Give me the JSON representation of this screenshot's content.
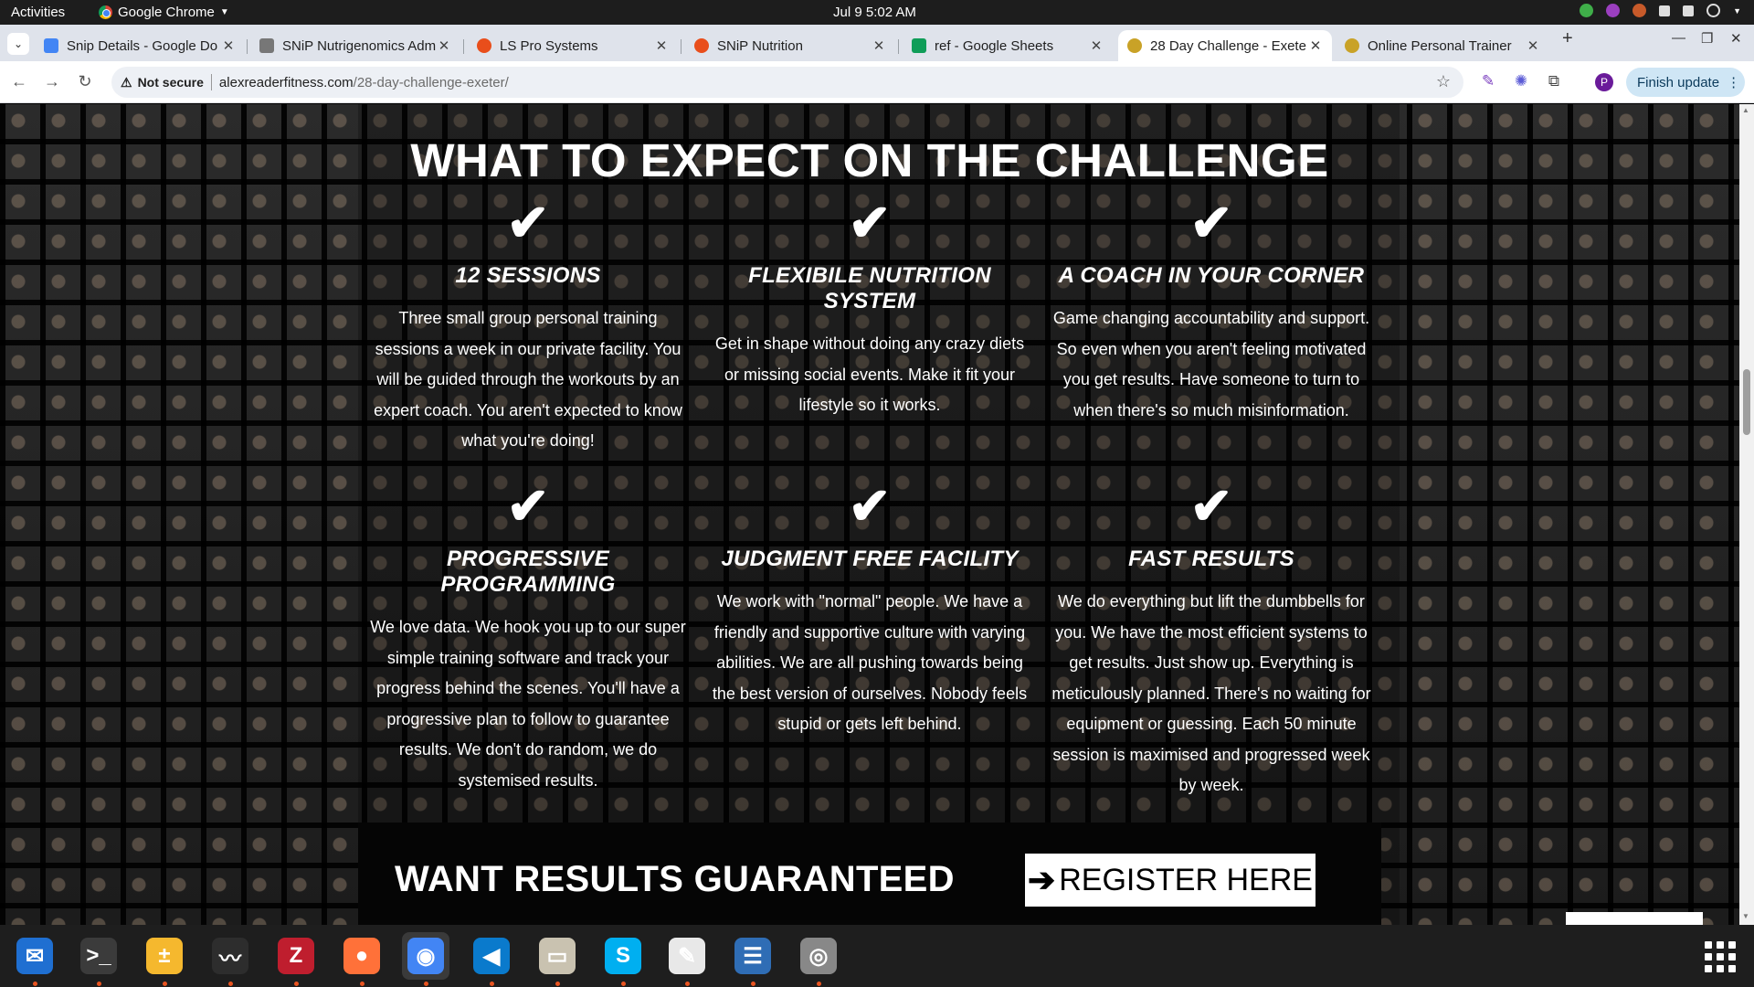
{
  "system": {
    "activities_label": "Activities",
    "app_menu_label": "Google Chrome",
    "clock": "Jul 9   5:02 AM"
  },
  "tabs": [
    {
      "label": "Snip Details - Google Do",
      "favicon_color": "#4285f4",
      "icon": "google-docs-icon"
    },
    {
      "label": "SNiP Nutrigenomics Adm",
      "favicon_color": "#777777",
      "icon": "snip-logo-icon"
    },
    {
      "label": "LS Pro Systems",
      "favicon_color": "#e94e1b",
      "icon": "ls-pro-icon"
    },
    {
      "label": "SNiP Nutrition",
      "favicon_color": "#e94e1b",
      "icon": "snip-nutrition-icon"
    },
    {
      "label": "ref - Google Sheets",
      "favicon_color": "#0f9d58",
      "icon": "google-sheets-icon"
    },
    {
      "label": "28 Day Challenge - Exete",
      "favicon_color": "#c9a227",
      "icon": "site-favicon-icon"
    },
    {
      "label": "Online Personal Trainer",
      "favicon_color": "#c9a227",
      "icon": "site-favicon-icon"
    }
  ],
  "toolbar": {
    "security_label": "Not secure",
    "url_host": "alexreaderfitness.com",
    "url_path": "/28-day-challenge-exeter/",
    "profile_initial": "P",
    "finish_update_label": "Finish update"
  },
  "page": {
    "heading": "WHAT TO EXPECT ON THE CHALLENGE",
    "features": [
      {
        "title": "12 SESSIONS",
        "text": "Three small group personal training sessions a week in our private facility. You will be guided through the workouts by an expert coach. You aren't expected to know what you're doing!"
      },
      {
        "title": "FLEXIBILE NUTRITION SYSTEM",
        "text": "Get in shape without doing any crazy diets or missing social events. Make it fit your lifestyle so it works."
      },
      {
        "title": "A COACH IN YOUR CORNER",
        "text": "Game changing accountability and support. So even when you aren't feeling motivated you get results. Have someone to turn to when there's so much misinformation."
      },
      {
        "title": "PROGRESSIVE PROGRAMMING",
        "text": "We love data. We hook you up to our super simple training software and track your progress behind the scenes. You'll have a progressive plan to follow to guarantee results. We don't do random, we do systemised results."
      },
      {
        "title": "JUDGMENT FREE FACILITY",
        "text": "We work with \"normal\" people. We have a friendly and supportive culture with varying abilities. We are all pushing towards being the best version of ourselves. Nobody feels stupid or gets left behind."
      },
      {
        "title": "FAST RESULTS",
        "text": "We do everything but lift the dumbbells for you. We have the most efficient systems to get results. Just show up. Everything is meticulously planned. There's no waiting for equipment or guessing. Each 50 minute session is maximised and progressed week by week."
      }
    ],
    "check_glyph": "✔",
    "cta_text": "WANT RESULTS GUARANTEED",
    "cta_button_label": "REGISTER HERE",
    "cta_arrow": "➔"
  },
  "dock": [
    {
      "name": "thunderbird-icon",
      "color": "#1f6fd1",
      "glyph": "✉",
      "active": false
    },
    {
      "name": "terminal-icon",
      "color": "#3b3b3b",
      "glyph": ">_",
      "active": false
    },
    {
      "name": "calculator-icon",
      "color": "#f5b82e",
      "glyph": "±",
      "active": false
    },
    {
      "name": "system-monitor-icon",
      "color": "#2d2d2d",
      "glyph": "〰",
      "active": false
    },
    {
      "name": "filezilla-icon",
      "color": "#bf1e2e",
      "glyph": "Z",
      "active": false
    },
    {
      "name": "firefox-icon",
      "color": "#ff7139",
      "glyph": "●",
      "active": false
    },
    {
      "name": "chrome-icon",
      "color": "#4285f4",
      "glyph": "◉",
      "active": true
    },
    {
      "name": "vscode-icon",
      "color": "#0a7acc",
      "glyph": "◀",
      "active": false
    },
    {
      "name": "files-icon",
      "color": "#c9c2b0",
      "glyph": "▭",
      "active": false
    },
    {
      "name": "skype-icon",
      "color": "#00aff0",
      "glyph": "S",
      "active": false
    },
    {
      "name": "text-editor-icon",
      "color": "#e8e8e8",
      "glyph": "✎",
      "active": false
    },
    {
      "name": "document-viewer-icon",
      "color": "#2f6db5",
      "glyph": "☰",
      "active": false
    },
    {
      "name": "disk-utility-icon",
      "color": "#888888",
      "glyph": "◎",
      "active": false
    }
  ]
}
